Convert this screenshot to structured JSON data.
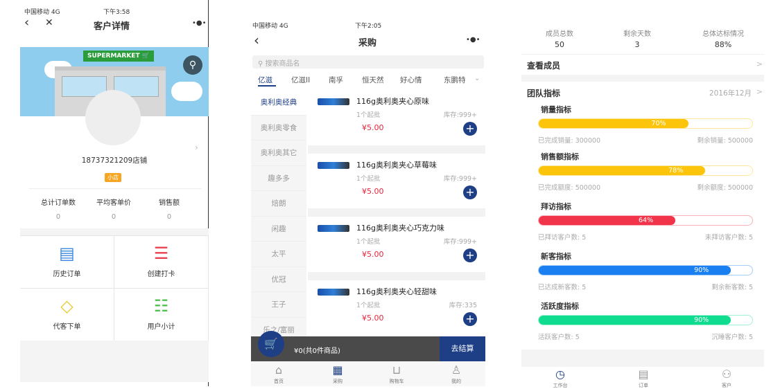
{
  "customer": {
    "status": {
      "carrier": "中国移动 4G",
      "time": "下午3:58"
    },
    "title": "客户详情",
    "more": "•●•",
    "banner_sign": "SUPERMARKET 🛒",
    "store_name": "18737321209店铺",
    "badge": "小店",
    "stats": [
      {
        "label": "总计订单数",
        "value": "0"
      },
      {
        "label": "平均客单价",
        "value": "0"
      },
      {
        "label": "销售额",
        "value": "0"
      }
    ],
    "actions": [
      {
        "label": "历史订单",
        "icon": "document-icon",
        "glyph": "▤",
        "color": "#3a86e0"
      },
      {
        "label": "创建打卡",
        "icon": "receipt-icon",
        "glyph": "☰",
        "color": "#e8404e"
      },
      {
        "label": "代客下单",
        "icon": "tag-icon",
        "glyph": "◇",
        "color": "#e8c82a"
      },
      {
        "label": "用户小计",
        "icon": "report-search-icon",
        "glyph": "☷",
        "color": "#4fc14a"
      }
    ]
  },
  "purchase": {
    "status": {
      "carrier": "中国移动 4G",
      "time": "下午2:05"
    },
    "title": "采购",
    "more": "•●•",
    "search_placeholder": "搜索商品名",
    "brands": [
      "亿滋",
      "亿滋II",
      "南孚",
      "恒天然",
      "好心情",
      "东鹏特"
    ],
    "categories": [
      "奥利奥经典",
      "奥利奥零食",
      "奥利奥其它",
      "趣多多",
      "焙朗",
      "闲趣",
      "太平",
      "优冠",
      "王子",
      "乐之/富丽"
    ],
    "products": [
      {
        "name": "116g奥利奥夹心原味",
        "min": "1个起批",
        "stock": "库存:999+",
        "price": "¥5.00"
      },
      {
        "name": "116g奥利奥夹心草莓味",
        "min": "1个起批",
        "stock": "库存:999+",
        "price": "¥5.00"
      },
      {
        "name": "116g奥利奥夹心巧克力味",
        "min": "1个起批",
        "stock": "库存:999+",
        "price": "¥5.00"
      },
      {
        "name": "116g奥利奥夹心轻甜味",
        "min": "1个起批",
        "stock": "库存:335",
        "price": "¥5.00"
      }
    ],
    "cart_summary": "¥0(共0件商品)",
    "checkout": "去结算",
    "tabs": [
      "首页",
      "采购",
      "购物车",
      "我的"
    ]
  },
  "team": {
    "stats": [
      {
        "label": "成员总数",
        "value": "50"
      },
      {
        "label": "剩余天数",
        "value": "3"
      },
      {
        "label": "总体达标情况",
        "value": "88%"
      }
    ],
    "view_members": "查看成员",
    "team_metrics": "团队指标",
    "month": "2016年12月",
    "metrics": [
      {
        "title": "销量指标",
        "percent": 70,
        "label": "70%",
        "left": "已完成销量: 300000",
        "right": "剩余销量: 500000",
        "color": "#fcc40a"
      },
      {
        "title": "销售额指标",
        "percent": 78,
        "label": "78%",
        "left": "已完成额度: 500000",
        "right": "剩余额度: 500000",
        "color": "#fcc40a"
      },
      {
        "title": "拜访指标",
        "percent": 64,
        "label": "64%",
        "left": "已拜访客户数: 5",
        "right": "未拜访客户数: 5",
        "color": "#f2344b"
      },
      {
        "title": "新客指标",
        "percent": 90,
        "label": "90%",
        "left": "已达成新客数: 5",
        "right": "剩余新客数: 5",
        "color": "#1a7ff0"
      },
      {
        "title": "活跃度指标",
        "percent": 90,
        "label": "90%",
        "left": "活跃客户数: 5",
        "right": "沉睡客户数: 5",
        "color": "#0fdc8f"
      }
    ],
    "tabs": [
      "工作台",
      "订单",
      "客户"
    ]
  }
}
